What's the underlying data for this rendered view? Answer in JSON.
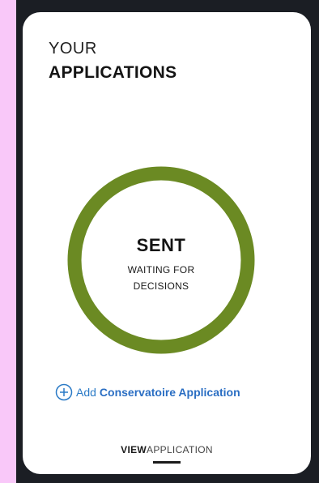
{
  "header": {
    "line1": "YOUR",
    "line2": "APPLICATIONS"
  },
  "status": {
    "main": "SENT",
    "sub_line1": "WAITING FOR",
    "sub_line2": "DECISIONS",
    "ring_color": "#6b8a23"
  },
  "add_application": {
    "icon": "plus-circle-icon",
    "prefix": "Add",
    "label": "Conservatoire Application",
    "color": "#2a6ec3"
  },
  "view_tab": {
    "bold": "VIEW",
    "light": "APPLICATION"
  }
}
